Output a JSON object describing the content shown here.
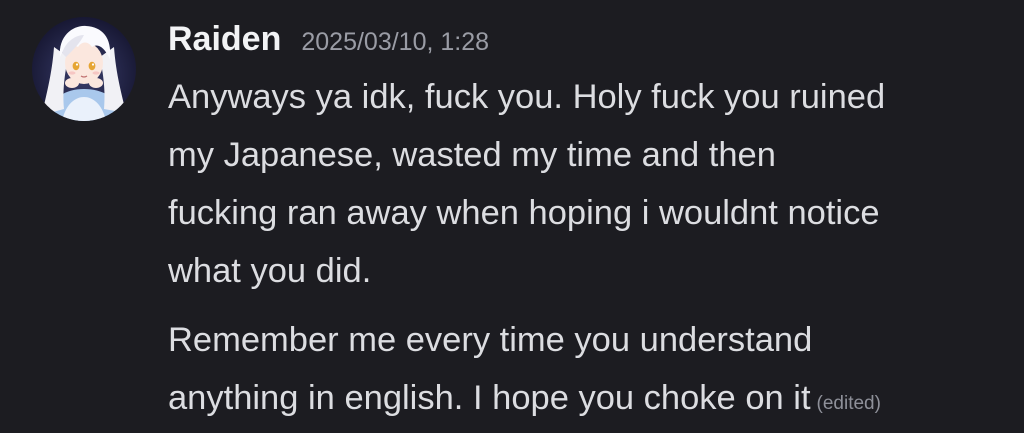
{
  "message": {
    "username": "Raiden",
    "timestamp": "2025/03/10, 1:28",
    "avatar_icon": "anime-girl-avatar",
    "paragraphs": [
      {
        "lines": [
          "Anyways ya idk, fuck you. Holy fuck you ruined",
          "my Japanese, wasted my time and then",
          "fucking ran away when hoping i wouldnt notice",
          "what you did."
        ]
      },
      {
        "lines": [
          "Remember me every time you understand",
          "anything in english. I hope you choke on it"
        ],
        "edited_label": "(edited)"
      }
    ]
  },
  "colors": {
    "background": "#1c1c21",
    "username": "#f2f3f5",
    "timestamp": "#9a9ca5",
    "message_text": "#dcdde1",
    "edited": "#8e9099"
  }
}
